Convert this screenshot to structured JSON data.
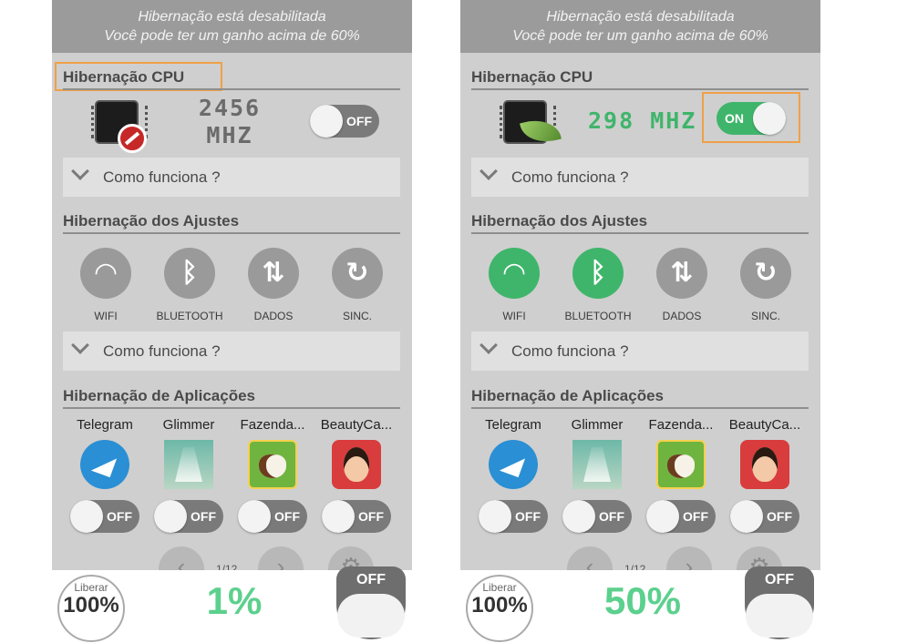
{
  "colors": {
    "accent": "#3fb56b",
    "highlight": "#f0a048",
    "banner": "#9b9b9b",
    "percent": "#5cd08d"
  },
  "phones": [
    {
      "banner_line1": "Hibernação está desabilitada",
      "banner_line2": "Você pode ter um ganho acima de 60%",
      "cpu_title": "Hibernação CPU",
      "cpu_freq": "2456 MHZ",
      "cpu_toggle": "OFF",
      "how_it_works": "Como funciona ?",
      "settings_title": "Hibernação dos Ajustes",
      "settings": [
        {
          "label": "WIFI",
          "icon": "wifi-icon",
          "state": "off"
        },
        {
          "label": "BLUETOOTH",
          "icon": "bluetooth-icon",
          "state": "off"
        },
        {
          "label": "DADOS",
          "icon": "data-icon",
          "state": "off"
        },
        {
          "label": "SINC.",
          "icon": "sync-icon",
          "state": "off"
        }
      ],
      "apps_title": "Hibernação de Aplicações",
      "apps": [
        {
          "name": "Telegram",
          "toggle": "OFF"
        },
        {
          "name": "Glimmer",
          "toggle": "OFF"
        },
        {
          "name": "Fazenda...",
          "toggle": "OFF"
        },
        {
          "name": "BeautyCa...",
          "toggle": "OFF"
        }
      ],
      "page_indicator": "1/12",
      "liberar_label": "Liberar",
      "liberar_value": "100%",
      "percent": "1%",
      "master_toggle": "OFF"
    },
    {
      "banner_line1": "Hibernação está desabilitada",
      "banner_line2": "Você pode ter um ganho acima de 60%",
      "cpu_title": "Hibernação CPU",
      "cpu_freq": "298 MHZ",
      "cpu_toggle": "ON",
      "how_it_works": "Como funciona ?",
      "settings_title": "Hibernação dos Ajustes",
      "settings": [
        {
          "label": "WIFI",
          "icon": "wifi-icon",
          "state": "on"
        },
        {
          "label": "BLUETOOTH",
          "icon": "bluetooth-icon",
          "state": "on"
        },
        {
          "label": "DADOS",
          "icon": "data-icon",
          "state": "off"
        },
        {
          "label": "SINC.",
          "icon": "sync-icon",
          "state": "off"
        }
      ],
      "apps_title": "Hibernação de Aplicações",
      "apps": [
        {
          "name": "Telegram",
          "toggle": "OFF"
        },
        {
          "name": "Glimmer",
          "toggle": "OFF"
        },
        {
          "name": "Fazenda...",
          "toggle": "OFF"
        },
        {
          "name": "BeautyCa...",
          "toggle": "OFF"
        }
      ],
      "page_indicator": "1/12",
      "liberar_label": "Liberar",
      "liberar_value": "100%",
      "percent": "50%",
      "master_toggle": "OFF"
    }
  ]
}
